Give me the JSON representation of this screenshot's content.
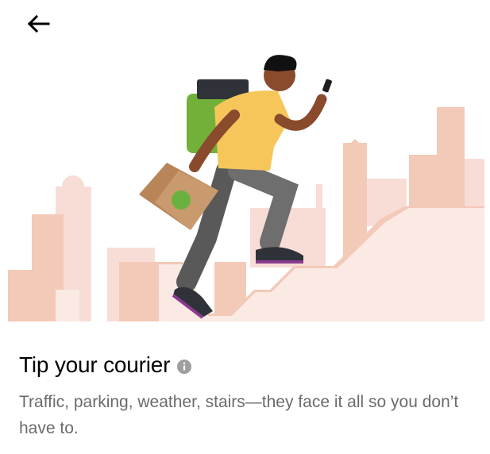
{
  "header": {
    "back_icon": "arrow-left-icon"
  },
  "illustration": {
    "subject": "courier-running-up-stairs",
    "colors": {
      "city_light": "#f7ddd6",
      "city_mid": "#f3c9b8",
      "shirt": "#f6c65b",
      "backpack": "#72b03a",
      "pants": "#595959",
      "bag": "#c99a6e",
      "bag_dot": "#6ab23e",
      "shoe_accent": "#8a3b8f"
    }
  },
  "content": {
    "title": "Tip your courier",
    "info_icon": "info-icon",
    "description": "Traffic, parking, weather, stairs—they face it all so you don’t have to."
  }
}
